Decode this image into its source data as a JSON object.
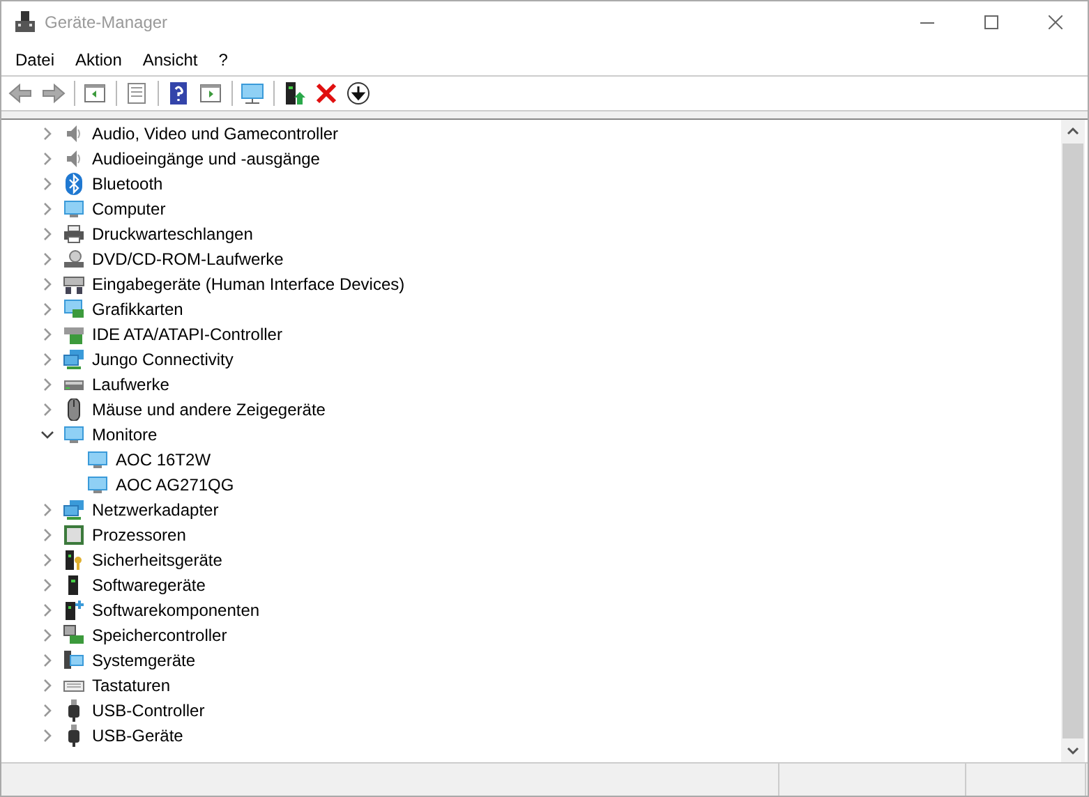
{
  "window": {
    "title": "Geräte-Manager"
  },
  "menu": [
    "Datei",
    "Aktion",
    "Ansicht",
    "?"
  ],
  "tree": [
    {
      "label": "Audio, Video und Gamecontroller",
      "expanded": false
    },
    {
      "label": "Audioeingänge und -ausgänge",
      "expanded": false
    },
    {
      "label": "Bluetooth",
      "expanded": false
    },
    {
      "label": "Computer",
      "expanded": false
    },
    {
      "label": "Druckwarteschlangen",
      "expanded": false
    },
    {
      "label": "DVD/CD-ROM-Laufwerke",
      "expanded": false
    },
    {
      "label": "Eingabegeräte (Human Interface Devices)",
      "expanded": false
    },
    {
      "label": "Grafikkarten",
      "expanded": false
    },
    {
      "label": "IDE ATA/ATAPI-Controller",
      "expanded": false
    },
    {
      "label": "Jungo Connectivity",
      "expanded": false
    },
    {
      "label": "Laufwerke",
      "expanded": false
    },
    {
      "label": "Mäuse und andere Zeigegeräte",
      "expanded": false
    },
    {
      "label": "Monitore",
      "expanded": true,
      "children": [
        {
          "label": "AOC 16T2W"
        },
        {
          "label": "AOC AG271QG"
        }
      ]
    },
    {
      "label": "Netzwerkadapter",
      "expanded": false
    },
    {
      "label": "Prozessoren",
      "expanded": false
    },
    {
      "label": "Sicherheitsgeräte",
      "expanded": false
    },
    {
      "label": "Softwaregeräte",
      "expanded": false
    },
    {
      "label": "Softwarekomponenten",
      "expanded": false
    },
    {
      "label": "Speichercontroller",
      "expanded": false
    },
    {
      "label": "Systemgeräte",
      "expanded": false
    },
    {
      "label": "Tastaturen",
      "expanded": false
    },
    {
      "label": "USB-Controller",
      "expanded": false
    },
    {
      "label": "USB-Geräte",
      "expanded": false
    }
  ]
}
